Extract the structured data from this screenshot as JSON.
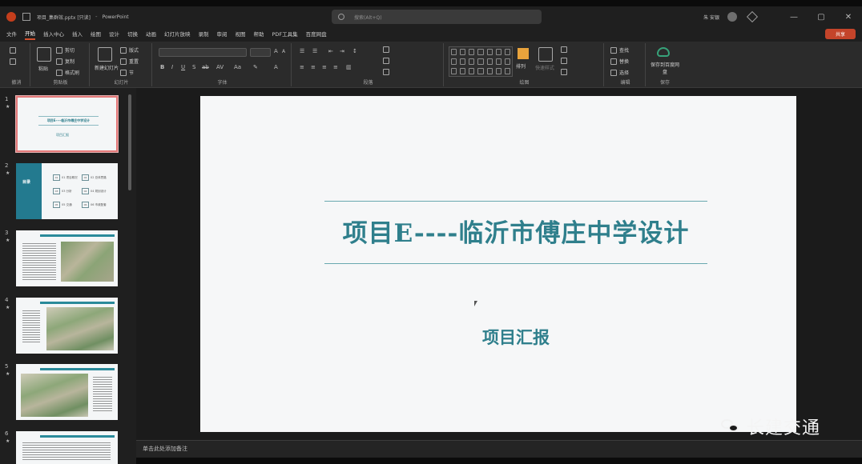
{
  "titlebar": {
    "filename": "项目_集群效.pptx [只读]",
    "separator": "-",
    "app_name": "PowerPoint",
    "search_placeholder": "搜索(Alt+Q)",
    "user_name": "朱 安银"
  },
  "menu": {
    "tabs": [
      "文件",
      "开始",
      "插入中心",
      "插入",
      "绘图",
      "设计",
      "切换",
      "动画",
      "幻灯片放映",
      "录制",
      "审阅",
      "视图",
      "帮助",
      "PDF工具集",
      "百度网盘"
    ],
    "active": "开始",
    "share_label": "共享"
  },
  "ribbon": {
    "groups": {
      "undo": "撤消",
      "clipboard": "剪贴板",
      "slides": "幻灯片",
      "font": "字体",
      "paragraph": "段落",
      "drawing": "绘图",
      "editing": "编辑",
      "save": "保存"
    },
    "clipboard": {
      "paste": "粘贴",
      "cut": "剪切",
      "copy": "复制",
      "format_painter": "格式刷"
    },
    "slides": {
      "new_slide": "新建幻灯片",
      "layout": "版式",
      "reset": "重置",
      "section": "节"
    },
    "drawing": {
      "arrange": "排列",
      "quick_styles": "快速样式"
    },
    "editing": {
      "find": "查找",
      "replace": "替换",
      "select": "选择"
    },
    "save": {
      "save_to_baidu": "保存到百度网盘"
    }
  },
  "thumbnails": [
    {
      "number": "1",
      "title": "项目E----临沂市傅庄中学设计",
      "subtitle": "项目汇报"
    },
    {
      "number": "2",
      "title": "目录",
      "items": [
        "01 项目概况",
        "02 总体思路",
        "03 分析",
        "04 规划设计",
        "05 交通",
        "06 市政配套"
      ]
    },
    {
      "number": "3"
    },
    {
      "number": "4"
    },
    {
      "number": "5"
    },
    {
      "number": "6"
    }
  ],
  "slide": {
    "title": "项目E----临沂市傅庄中学设计",
    "subtitle": "项目汇报"
  },
  "notes_placeholder": "单击此处添加备注",
  "watermark": {
    "text": "长建交通"
  },
  "colors": {
    "accent": "#2f7f8c",
    "ribbon_active": "#d35230",
    "share": "#c4442a"
  }
}
